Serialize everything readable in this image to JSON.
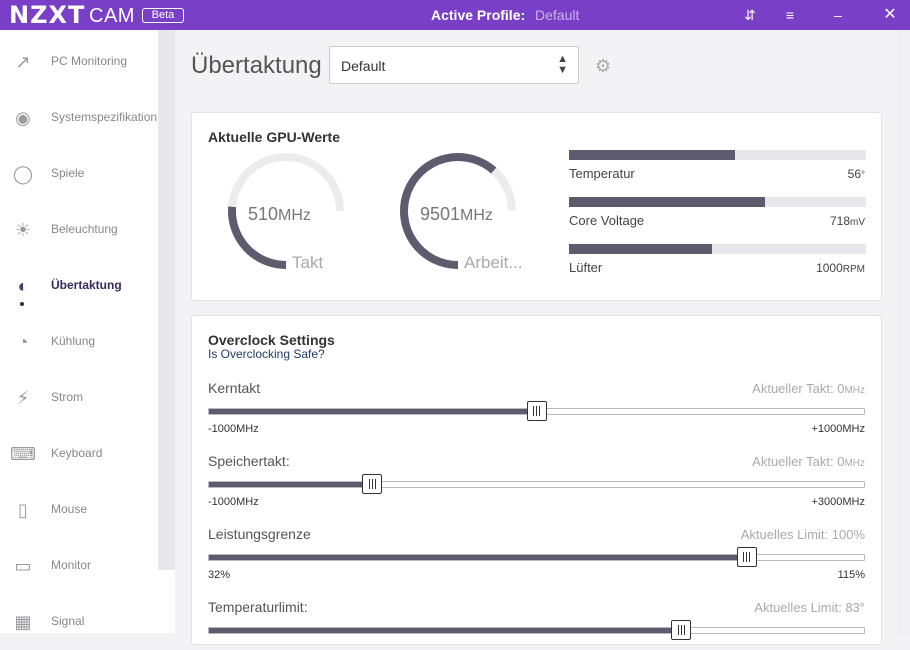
{
  "titlebar": {
    "brand": "NZXT",
    "product": "CAM",
    "beta": "Beta",
    "active_profile_label": "Active Profile:",
    "active_profile_value": "Default"
  },
  "sidebar": {
    "items": [
      {
        "label": "PC Monitoring",
        "icon": "chart-line-icon"
      },
      {
        "label": "Systemspezifikation",
        "icon": "eye-icon"
      },
      {
        "label": "Spiele",
        "icon": "gamepad-icon"
      },
      {
        "label": "Beleuchtung",
        "icon": "sun-icon"
      },
      {
        "label": "Übertaktung",
        "icon": "speedometer-icon",
        "active": true
      },
      {
        "label": "Kühlung",
        "icon": "fan-icon"
      },
      {
        "label": "Strom",
        "icon": "bolt-icon"
      },
      {
        "label": "Keyboard",
        "icon": "keyboard-icon"
      },
      {
        "label": "Mouse",
        "icon": "mouse-icon"
      },
      {
        "label": "Monitor",
        "icon": "monitor-icon"
      },
      {
        "label": "Signal",
        "icon": "signal-device-icon"
      }
    ]
  },
  "page": {
    "title": "Übertaktung",
    "profile_select": "Default"
  },
  "gpu": {
    "title": "Aktuelle GPU-Werte",
    "gauges": [
      {
        "value": "510",
        "unit": "MHz",
        "label": "Takt",
        "fraction": 0.35
      },
      {
        "value": "9501",
        "unit": "MHz",
        "label": "Arbeit...",
        "fraction": 0.82
      }
    ],
    "bars": [
      {
        "label": "Temperatur",
        "value": "56",
        "unit": "°",
        "fraction": 0.56
      },
      {
        "label": "Core Voltage",
        "value": "718",
        "unit": "mV",
        "fraction": 0.66
      },
      {
        "label": "Lüfter",
        "value": "1000",
        "unit": "RPM",
        "fraction": 0.48
      }
    ]
  },
  "overclock": {
    "title": "Overclock Settings",
    "subtitle": "Is Overclocking Safe?",
    "sliders": [
      {
        "label": "Kerntakt",
        "current": "Aktueller Takt: 0",
        "current_unit": "MHz",
        "min": "-1000MHz",
        "max": "+1000MHz",
        "fraction": 0.5
      },
      {
        "label": "Speichertakt:",
        "current": "Aktueller Takt: 0",
        "current_unit": "MHz",
        "min": "-1000MHz",
        "max": "+3000MHz",
        "fraction": 0.25
      },
      {
        "label": "Leistungsgrenze",
        "current": "Aktuelles Limit: 100%",
        "current_unit": "",
        "min": "32%",
        "max": "115%",
        "fraction": 0.82
      },
      {
        "label": "Temperaturlimit:",
        "current": "Aktuelles Limit: 83°",
        "current_unit": "",
        "min": "",
        "max": "",
        "fraction": 0.72
      }
    ]
  },
  "colors": {
    "accent": "#7a3fc7",
    "fill": "#5e5b6e"
  }
}
